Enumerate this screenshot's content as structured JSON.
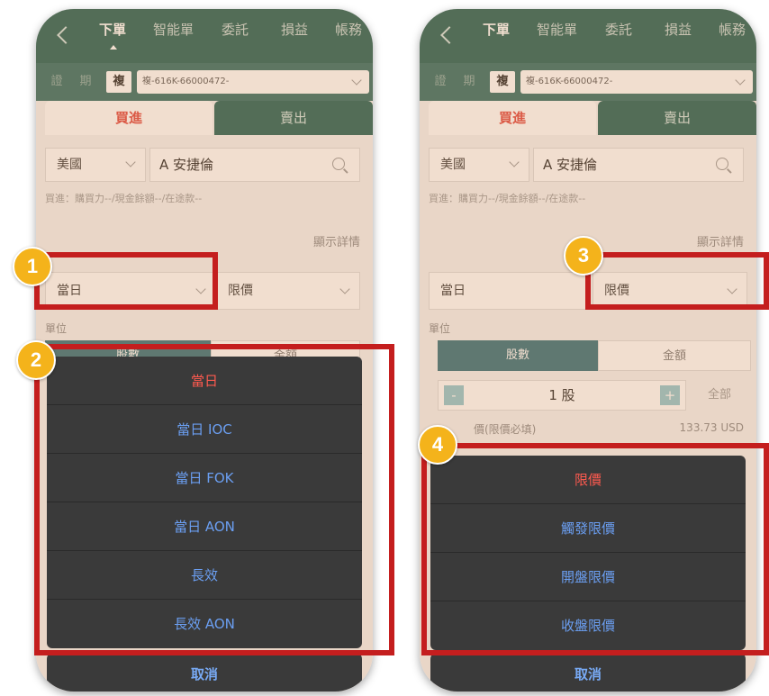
{
  "nav_tabs": [
    "下單",
    "智能單",
    "委託",
    "損益",
    "帳務"
  ],
  "account": {
    "segments": [
      "證",
      "期",
      "複"
    ],
    "account_text": "複-616K-66000472-"
  },
  "order_side": {
    "buy": "買進",
    "sell": "賣出"
  },
  "form": {
    "market": "美國",
    "stock": "A 安捷倫",
    "buying_power": "買進：購買力--/現金餘額--/在途款--",
    "show_detail": "顯示詳情",
    "duration": "當日",
    "price_type": "限價",
    "unit_label": "單位",
    "unit_shares": "股數",
    "unit_amount": "金額",
    "quantity_minus": "-",
    "quantity": "1 股",
    "quantity_plus": "+",
    "quantity_all": "全部",
    "price_label": "價(限價必填)",
    "price_value": "133.73 USD"
  },
  "left_sheet": {
    "options": [
      "當日",
      "當日 IOC",
      "當日 FOK",
      "當日 AON",
      "長效",
      "長效 AON"
    ],
    "cancel": "取消"
  },
  "right_sheet": {
    "options": [
      "限價",
      "觸發限價",
      "開盤限價",
      "收盤限價"
    ],
    "cancel": "取消"
  },
  "badges": [
    "1",
    "2",
    "3",
    "4"
  ],
  "colors": {
    "highlight": "#c41e1e",
    "badge": "#f4b31b",
    "nav": "#1d5d54",
    "selected_option": "#ff5a4f",
    "option": "#6b9ff2"
  }
}
